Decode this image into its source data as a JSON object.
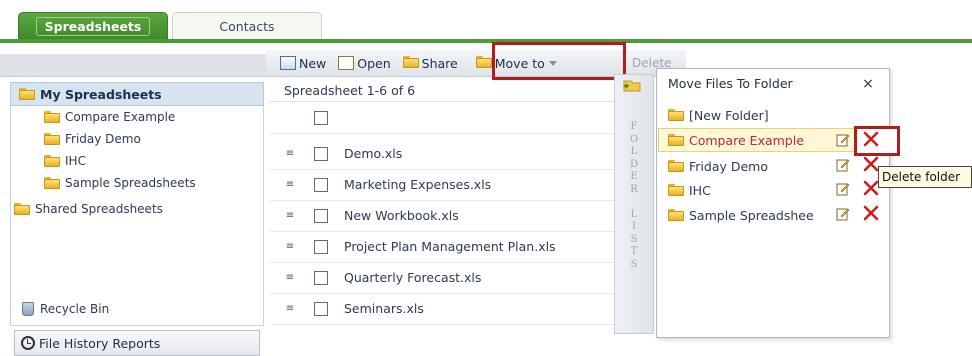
{
  "tabs": {
    "active": "Spreadsheets",
    "inactive": "Contacts"
  },
  "sidebar": {
    "header": "My Spreadsheets",
    "items": [
      {
        "label": "Compare Example"
      },
      {
        "label": "Friday Demo"
      },
      {
        "label": "IHC"
      },
      {
        "label": "Sample Spreadsheets"
      }
    ],
    "shared": "Shared Spreadsheets",
    "recycle": "Recycle Bin",
    "history": "File History Reports"
  },
  "toolbar": {
    "new_label": "New",
    "open_label": "Open",
    "share_label": "Share",
    "move_label": "Move to",
    "cut_text": "Delete  Track Calls  More"
  },
  "list": {
    "header": "Spreadsheet 1-6 of 6",
    "rows": [
      {
        "name": "Demo.xls"
      },
      {
        "name": "Marketing Expenses.xls"
      },
      {
        "name": "New Workbook.xls"
      },
      {
        "name": "Project Plan Management Plan.xls"
      },
      {
        "name": "Quarterly Forecast.xls"
      },
      {
        "name": "Seminars.xls"
      }
    ]
  },
  "strip": {
    "text": [
      "F",
      "O",
      "L",
      "D",
      "E",
      "R",
      "",
      "L",
      "I",
      "S",
      "T",
      "S"
    ]
  },
  "popup": {
    "title": "Move Files To Folder",
    "close": "×",
    "new_folder": "[New Folder]",
    "folders": [
      {
        "label": "Compare Example",
        "selected": true
      },
      {
        "label": "Friday Demo"
      },
      {
        "label": "IHC"
      },
      {
        "label": "Sample Spreadshee"
      }
    ],
    "tooltip": "Delete folder"
  },
  "colors": {
    "accent_green": "#4e9a34",
    "highlight_red": "#b01d1d",
    "delete_x": "#d11a1a"
  }
}
